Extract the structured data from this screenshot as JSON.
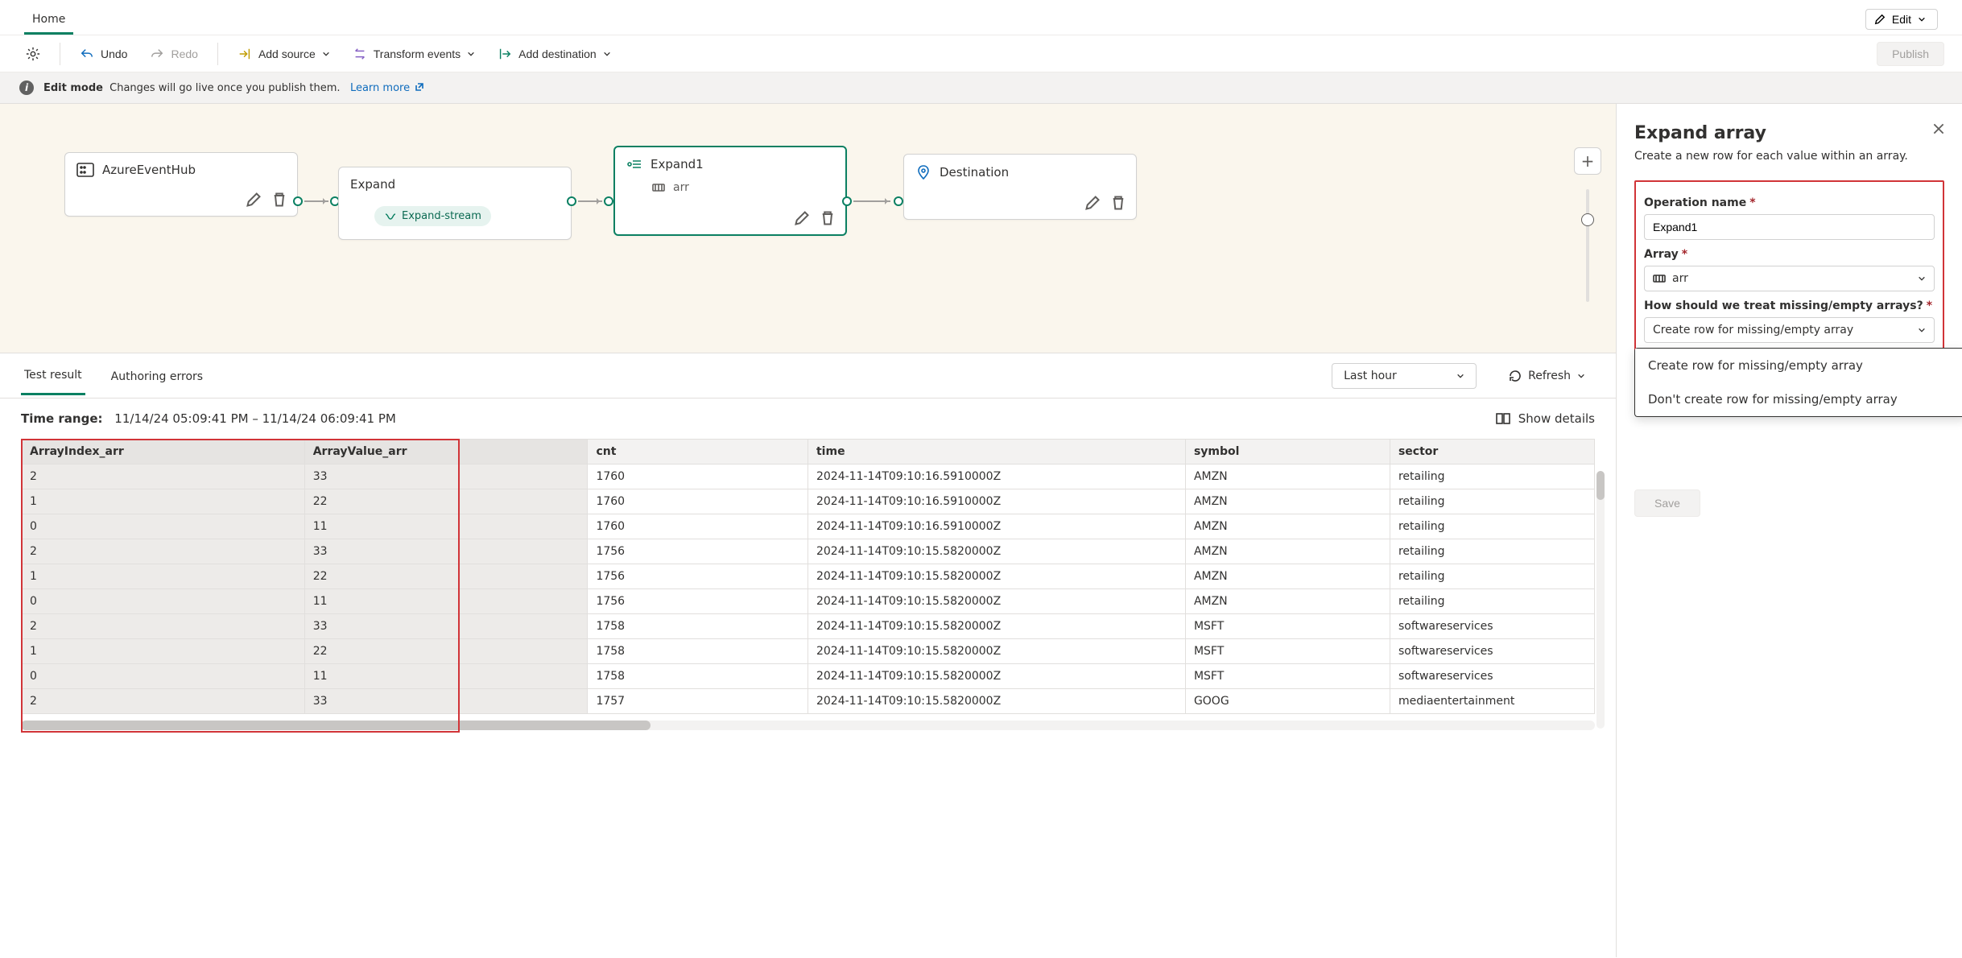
{
  "header": {
    "home_tab": "Home",
    "edit_label": "Edit"
  },
  "cmd": {
    "undo": "Undo",
    "redo": "Redo",
    "add_source": "Add source",
    "transform": "Transform events",
    "add_dest": "Add destination",
    "publish": "Publish"
  },
  "banner": {
    "title": "Edit mode",
    "text": "Changes will go live once you publish them.",
    "learn_more": "Learn more"
  },
  "canvas": {
    "azure": "AzureEventHub",
    "expand": "Expand",
    "expand_chip": "Expand-stream",
    "expand1": "Expand1",
    "expand1_sub": "arr",
    "destination": "Destination"
  },
  "results": {
    "tab_test": "Test result",
    "tab_errors": "Authoring errors",
    "range_select": "Last hour",
    "refresh": "Refresh"
  },
  "time": {
    "label": "Time range:",
    "value": "11/14/24 05:09:41 PM  –  11/14/24 06:09:41 PM",
    "show_details": "Show details"
  },
  "table": {
    "cols": [
      "ArrayIndex_arr",
      "ArrayValue_arr",
      "cnt",
      "time",
      "symbol",
      "sector"
    ],
    "rows": [
      [
        "2",
        "33",
        "1760",
        "2024-11-14T09:10:16.5910000Z",
        "AMZN",
        "retailing"
      ],
      [
        "1",
        "22",
        "1760",
        "2024-11-14T09:10:16.5910000Z",
        "AMZN",
        "retailing"
      ],
      [
        "0",
        "11",
        "1760",
        "2024-11-14T09:10:16.5910000Z",
        "AMZN",
        "retailing"
      ],
      [
        "2",
        "33",
        "1756",
        "2024-11-14T09:10:15.5820000Z",
        "AMZN",
        "retailing"
      ],
      [
        "1",
        "22",
        "1756",
        "2024-11-14T09:10:15.5820000Z",
        "AMZN",
        "retailing"
      ],
      [
        "0",
        "11",
        "1756",
        "2024-11-14T09:10:15.5820000Z",
        "AMZN",
        "retailing"
      ],
      [
        "2",
        "33",
        "1758",
        "2024-11-14T09:10:15.5820000Z",
        "MSFT",
        "softwareservices"
      ],
      [
        "1",
        "22",
        "1758",
        "2024-11-14T09:10:15.5820000Z",
        "MSFT",
        "softwareservices"
      ],
      [
        "0",
        "11",
        "1758",
        "2024-11-14T09:10:15.5820000Z",
        "MSFT",
        "softwareservices"
      ],
      [
        "2",
        "33",
        "1757",
        "2024-11-14T09:10:15.5820000Z",
        "GOOG",
        "mediaentertainment"
      ]
    ]
  },
  "panel": {
    "title": "Expand array",
    "desc": "Create a new row for each value within an array.",
    "op_label": "Operation name",
    "op_value": "Expand1",
    "array_label": "Array",
    "array_value": "arr",
    "missing_label": "How should we treat missing/empty arrays?",
    "missing_value": "Create row for missing/empty array",
    "option1": "Create row for missing/empty array",
    "option2": "Don't create row for missing/empty array",
    "save": "Save"
  }
}
